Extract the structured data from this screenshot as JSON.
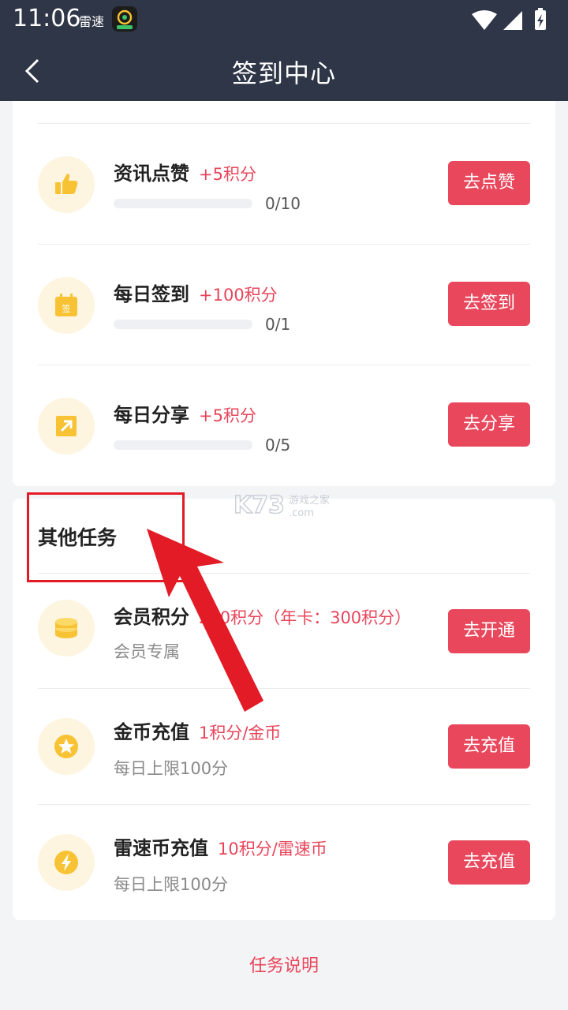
{
  "status": {
    "time": "11:06",
    "carrier": "雷速"
  },
  "nav": {
    "title": "签到中心"
  },
  "tasks": [
    {
      "name": "资讯点赞",
      "reward": "+5积分",
      "progress_text": "0/10",
      "progress": 0,
      "button": "去点赞",
      "icon": "thumbs-up-icon"
    },
    {
      "name": "每日签到",
      "reward": "+100积分",
      "progress_text": "0/1",
      "progress": 0,
      "button": "去签到",
      "icon": "calendar-sign-icon"
    },
    {
      "name": "每日分享",
      "reward": "+5积分",
      "progress_text": "0/5",
      "progress": 0,
      "button": "去分享",
      "icon": "share-arrow-icon"
    }
  ],
  "other_tasks": {
    "title": "其他任务",
    "items": [
      {
        "name": "会员积分",
        "reward": "200积分（年卡：300积分）",
        "subtitle": "会员专属",
        "button": "去开通",
        "icon": "coin-stack-icon"
      },
      {
        "name": "金币充值",
        "reward": "1积分/金币",
        "subtitle": "每日上限100分",
        "button": "去充值",
        "icon": "star-coin-icon"
      },
      {
        "name": "雷速币充值",
        "reward": "10积分/雷速币",
        "subtitle": "每日上限100分",
        "button": "去充值",
        "icon": "lightning-coin-icon"
      }
    ]
  },
  "watermark": {
    "brand": "K73",
    "tagline": "游戏之家",
    "domain": ".com"
  },
  "footer": {
    "link": "任务说明"
  },
  "colors": {
    "accent": "#e8455a",
    "navbar": "#2e3647",
    "icon_bg": "#fdf5df",
    "icon_yellow": "#f7c335",
    "annotation": "#e21b26"
  }
}
